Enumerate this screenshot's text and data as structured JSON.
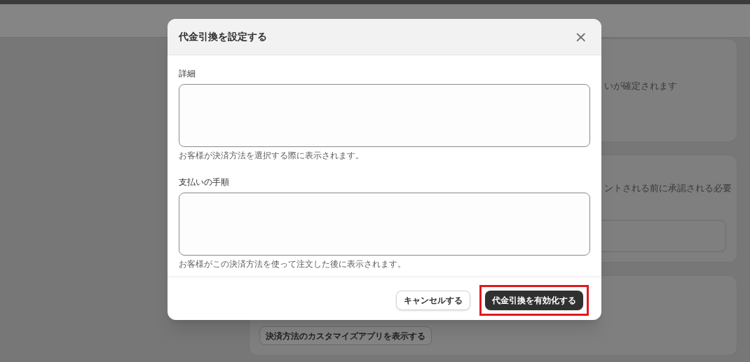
{
  "background_page": {
    "cards": [
      {
        "kind": "text",
        "text": "いが確定されます"
      },
      {
        "kind": "text_field",
        "text": "ントされる前に承認される必要"
      },
      {
        "kind": "button",
        "button": "決済方法のカスタマイズアプリを表示する"
      }
    ]
  },
  "dialog": {
    "title": "代金引換を設定する",
    "close": "×",
    "fields": [
      {
        "label": "詳細",
        "help": "お客様が決済方法を選択する際に表示されます。"
      },
      {
        "label": "支払いの手順",
        "help": "お客様がこの決済方法を使って注文した後に表示されます。"
      }
    ],
    "buttons": [
      {
        "label": "キャンセルする",
        "kind": "secondary",
        "highlighted": false
      },
      {
        "label": "代金引換を有効化する",
        "kind": "primary",
        "highlighted": true
      }
    ]
  }
}
